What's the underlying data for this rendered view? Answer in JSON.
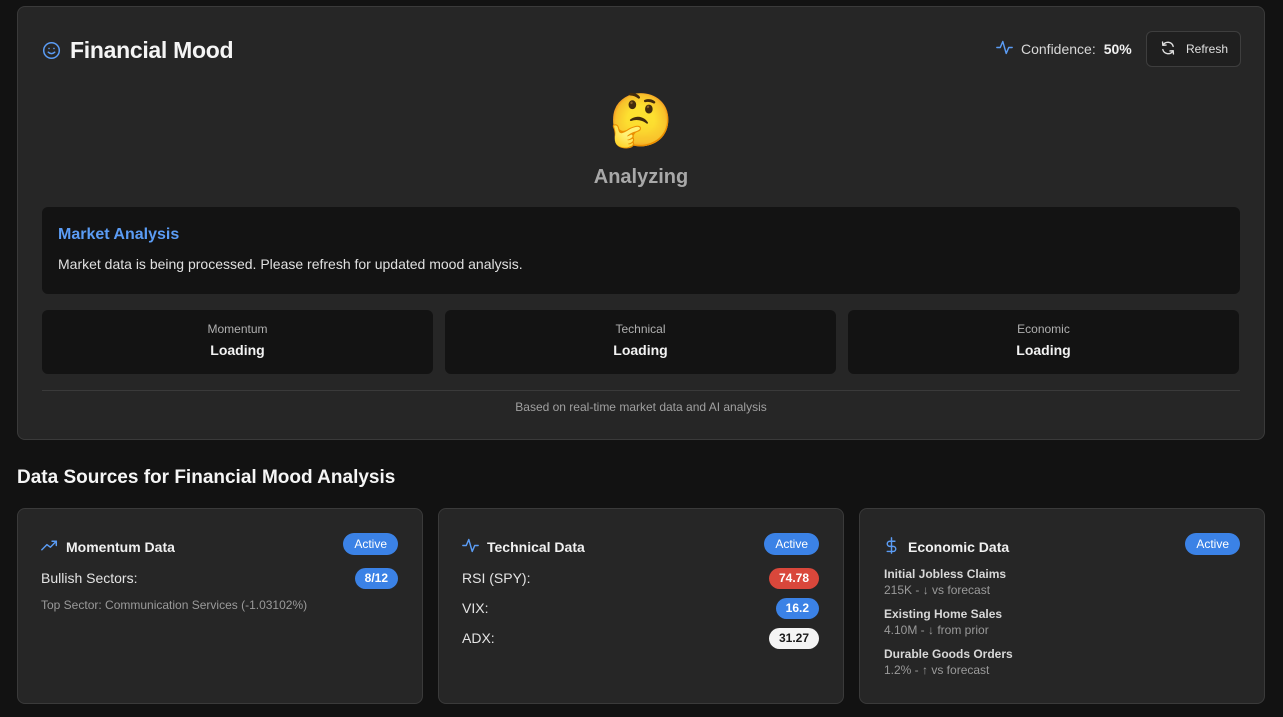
{
  "header": {
    "title": "Financial Mood",
    "confidence_label": "Confidence:",
    "confidence_value": "50%",
    "refresh_label": "Refresh"
  },
  "mood": {
    "emoji": "🤔",
    "label": "Analyzing"
  },
  "analysis": {
    "title": "Market Analysis",
    "text": "Market data is being processed. Please refresh for updated mood analysis."
  },
  "factors": [
    {
      "label": "Momentum",
      "value": "Loading"
    },
    {
      "label": "Technical",
      "value": "Loading"
    },
    {
      "label": "Economic",
      "value": "Loading"
    }
  ],
  "footnote": "Based on real-time market data and AI analysis",
  "sources_title": "Data Sources for Financial Mood Analysis",
  "sources": {
    "momentum": {
      "title": "Momentum Data",
      "status": "Active",
      "rows": [
        {
          "label": "Bullish Sectors:",
          "value": "8/12"
        }
      ],
      "note": "Top Sector: Communication Services (-1.03102%)"
    },
    "technical": {
      "title": "Technical Data",
      "status": "Active",
      "rows": [
        {
          "label": "RSI (SPY):",
          "value": "74.78",
          "color": "#d9473b"
        },
        {
          "label": "VIX:",
          "value": "16.2",
          "color": "#3b82e6"
        },
        {
          "label": "ADX:",
          "value": "31.27",
          "color": "#f4f4f4"
        }
      ]
    },
    "economic": {
      "title": "Economic Data",
      "status": "Active",
      "items": [
        {
          "name": "Initial Jobless Claims",
          "detail": "215K - ↓ vs forecast"
        },
        {
          "name": "Existing Home Sales",
          "detail": "4.10M - ↓ from prior"
        },
        {
          "name": "Durable Goods Orders",
          "detail": "1.2% - ↑ vs forecast"
        }
      ]
    }
  },
  "colors": {
    "accent": "#5b9cf4",
    "badge": "#3b82e6",
    "danger": "#d9473b",
    "background": "#121212",
    "card": "#262626"
  },
  "icons": {
    "title": "smile-icon",
    "confidence": "activity-icon",
    "refresh": "refresh-icon",
    "momentum": "trending-up-icon",
    "technical": "activity-icon",
    "economic": "dollar-icon"
  }
}
